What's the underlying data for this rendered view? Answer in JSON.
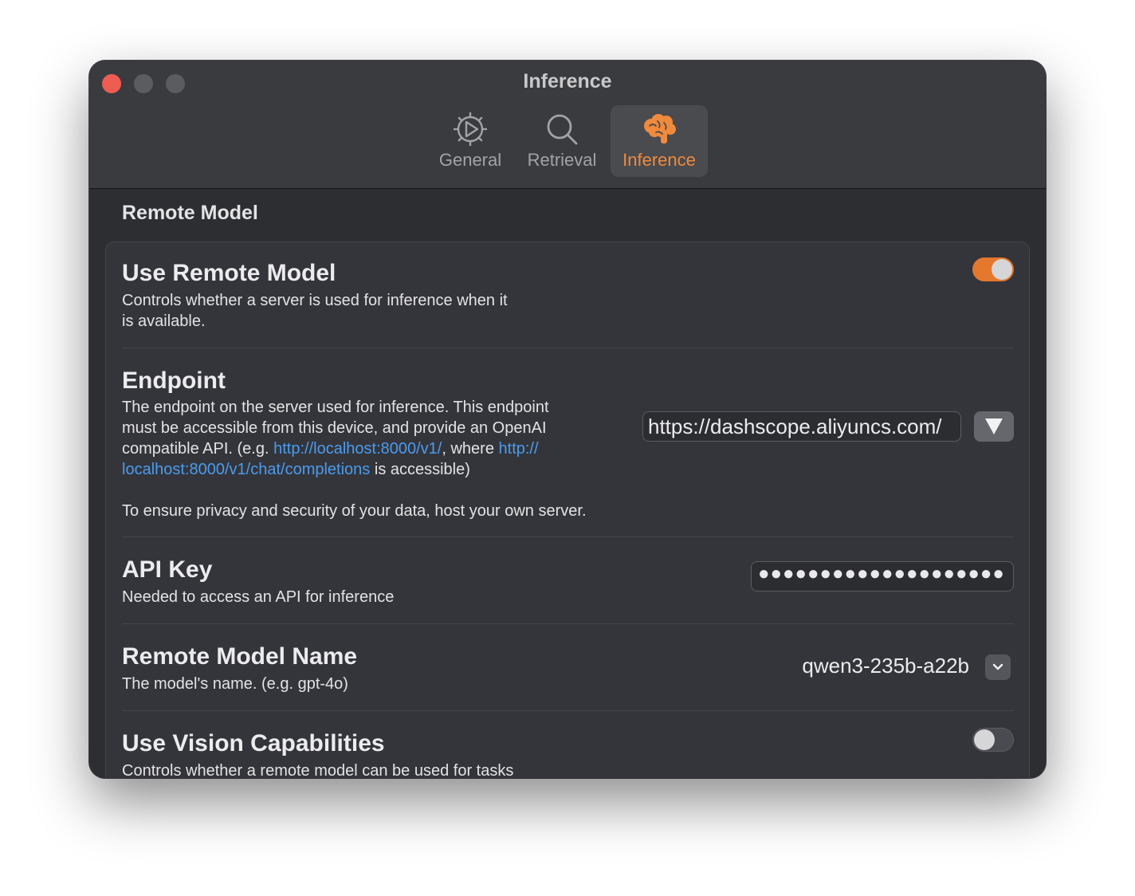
{
  "window": {
    "title": "Inference"
  },
  "tabs": [
    {
      "label": "General",
      "icon": "gear-play-icon"
    },
    {
      "label": "Retrieval",
      "icon": "magnifier-icon"
    },
    {
      "label": "Inference",
      "icon": "brain-icon",
      "active": true
    }
  ],
  "section": {
    "title": "Remote Model"
  },
  "use_remote_model": {
    "title": "Use Remote Model",
    "desc_line1": "Controls whether a server is used for inference when it",
    "desc_line2": "is available.",
    "enabled": true
  },
  "endpoint": {
    "title": "Endpoint",
    "line1": "The endpoint on the server used for inference. This endpoint",
    "line2": "must be accessible from this device, and provide an OpenAI",
    "line3_pre": "compatible API. (e.g. ",
    "link1": "http://localhost:8000/v1/",
    "line3_mid": ", where ",
    "link2a": "http://",
    "link2b": "localhost:8000/v1/chat/completions",
    "line4_post": " is accessible)",
    "privacy": "To ensure privacy and security of your data, host your own server.",
    "value": "https://dashscope.aliyuncs.com/"
  },
  "api_key": {
    "title": "API Key",
    "desc": "Needed to access an API for inference",
    "masked_value": "●●●●●●●●●●●●●●●●●●●●"
  },
  "remote_model_name": {
    "title": "Remote Model Name",
    "desc": "The model's name. (e.g. gpt-4o)",
    "value": "qwen3-235b-a22b"
  },
  "vision": {
    "title": "Use Vision Capabilities",
    "desc": "Controls whether a remote model can be used for tasks",
    "enabled": false
  },
  "colors": {
    "accent": "#e5782d",
    "link": "#4a9bf0",
    "window_bg": "#2d2e32"
  }
}
